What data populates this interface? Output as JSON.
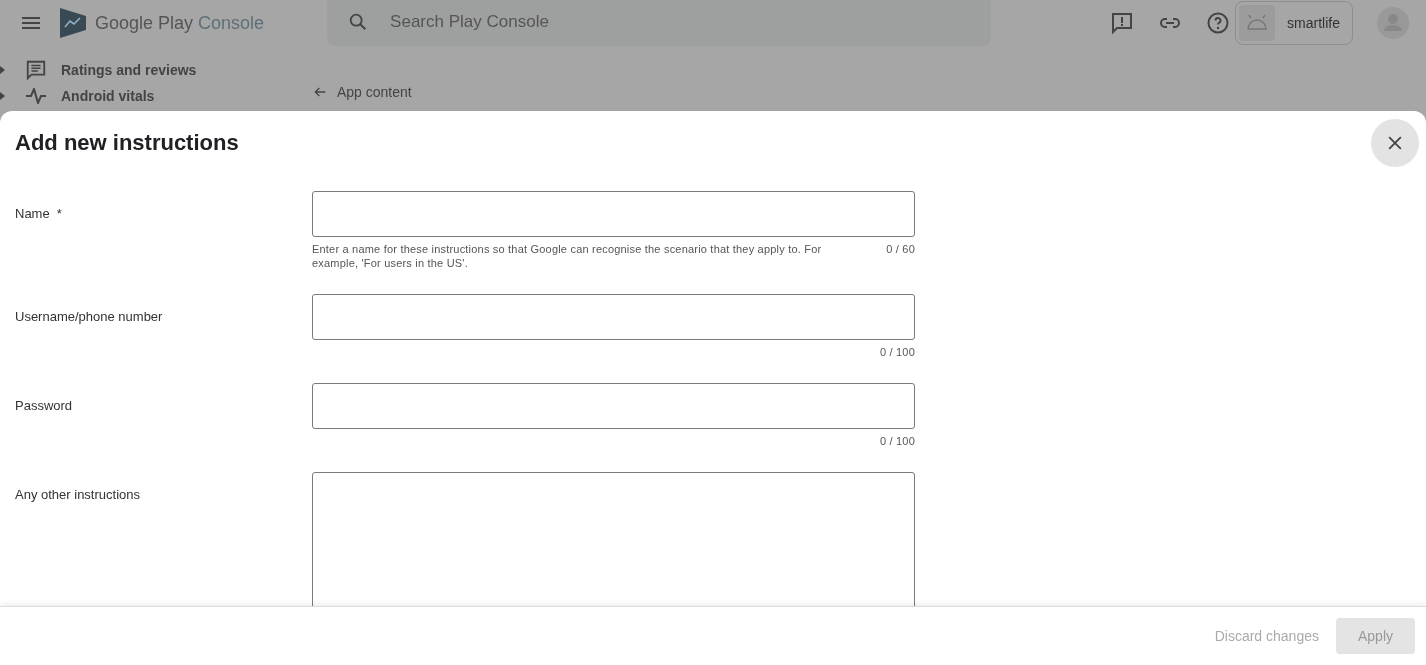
{
  "app_bar": {
    "brand": "Google Play",
    "product": "Console",
    "search": {
      "placeholder": "Search Play Console"
    },
    "account": "smartlife"
  },
  "sidebar": {
    "items": [
      {
        "label": "Ratings and reviews"
      },
      {
        "label": "Android vitals"
      }
    ]
  },
  "breadcrumb": {
    "label": "App content"
  },
  "dialog": {
    "title": "Add new instructions",
    "fields": [
      {
        "kind": "line",
        "label": "Name",
        "required_mark": "*",
        "helper": "Enter a name for these instructions so that Google can recognise the scenario that they apply to. For example, 'For users in the US'.",
        "counter": "0 / 60"
      },
      {
        "kind": "line",
        "label": "Username/phone number",
        "counter": "0 / 100"
      },
      {
        "kind": "line",
        "label": "Password",
        "counter": "0 / 100"
      },
      {
        "kind": "area",
        "label": "Any other instructions"
      }
    ],
    "buttons": [
      {
        "label": "Discard changes",
        "kind": "text",
        "disabled": true
      },
      {
        "label": "Apply",
        "kind": "filled",
        "disabled": true
      }
    ]
  }
}
